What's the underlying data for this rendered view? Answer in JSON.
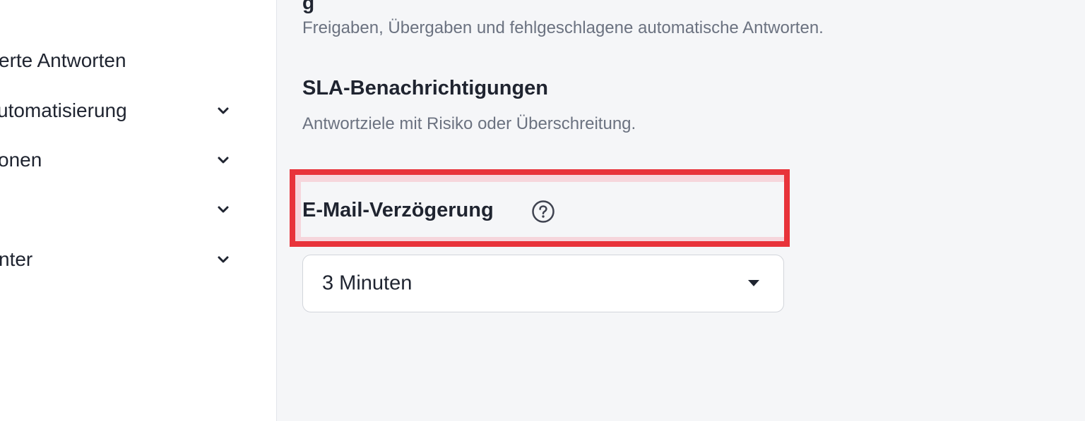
{
  "sidebar": {
    "items": [
      {
        "label": "erte Antworten",
        "has_chevron": false
      },
      {
        "label": "utomatisierung",
        "has_chevron": true,
        "icon": "chevron-down-icon"
      },
      {
        "label": "onen",
        "has_chevron": true,
        "icon": "chevron-down-icon"
      },
      {
        "label": "",
        "has_chevron": true,
        "icon": "chevron-down-icon"
      },
      {
        "label": "nter",
        "has_chevron": true,
        "icon": "chevron-down-icon"
      }
    ]
  },
  "main": {
    "cut_heading": "g",
    "sections": [
      {
        "title": "",
        "description": "Freigaben, Übergaben und fehlgeschlagene automatische Antworten."
      },
      {
        "title": "SLA-Benachrichtigungen",
        "description": "Antwortziele mit Risiko oder Überschreitung."
      }
    ],
    "email_delay": {
      "label": "E-Mail-Verzögerung",
      "help_icon": "question-circle-icon",
      "select_value": "3 Minuten",
      "select_icon": "caret-down-icon"
    }
  },
  "colors": {
    "highlight_border": "#e8333a",
    "background": "#f5f6f8",
    "sidebar_background": "#ffffff"
  }
}
